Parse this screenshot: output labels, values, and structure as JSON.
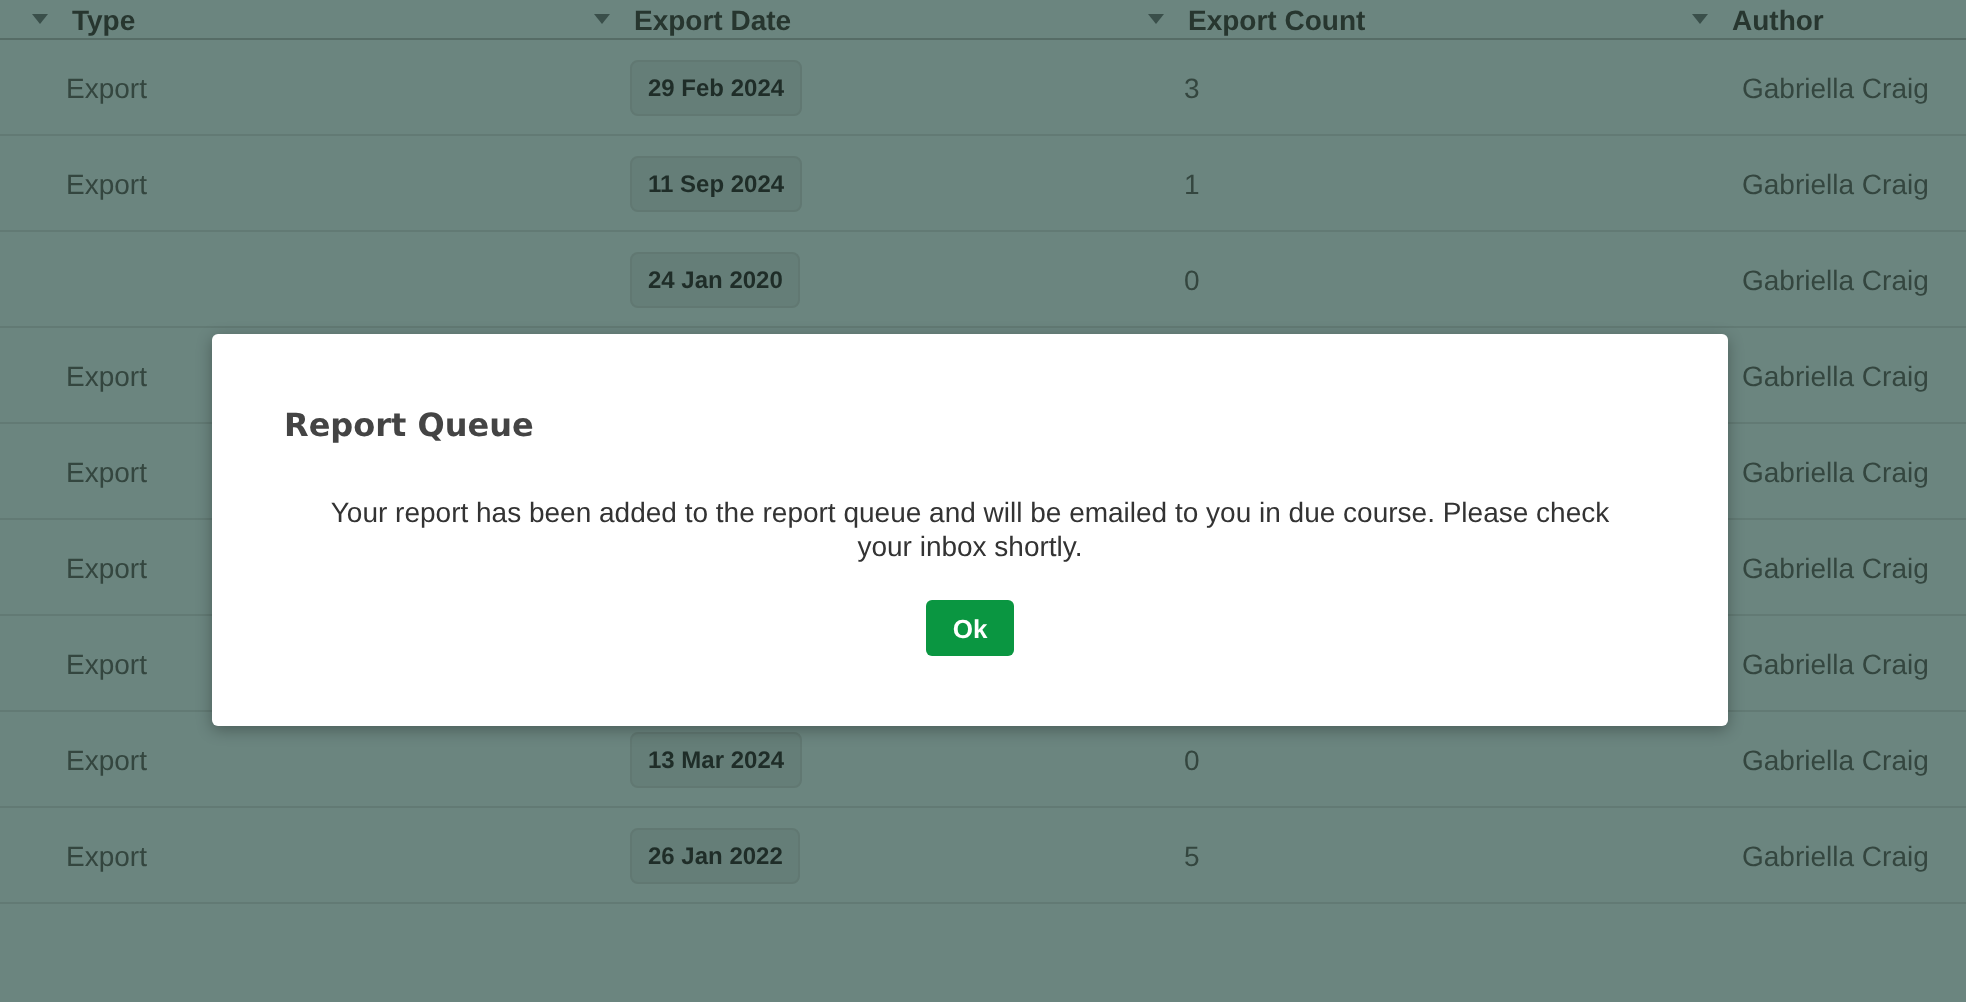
{
  "table": {
    "columns": [
      "Type",
      "Export Date",
      "Export Count",
      "Author"
    ],
    "rows": [
      {
        "type": "Export",
        "export_date": "29 Feb 2024",
        "export_count": "3",
        "author": "Gabriella Craig"
      },
      {
        "type": "Export",
        "export_date": "11 Sep 2024",
        "export_count": "1",
        "author": "Gabriella Craig"
      },
      {
        "export_date": "24 Jan 2020",
        "export_count": "0",
        "author": "Gabriella Craig"
      },
      {
        "type": "Export",
        "author": "Gabriella Craig"
      },
      {
        "type": "Export",
        "author": "Gabriella Craig"
      },
      {
        "type": "Export",
        "author": "Gabriella Craig"
      },
      {
        "type": "Export",
        "author": "Gabriella Craig"
      },
      {
        "type": "Export",
        "export_date": "13 Mar 2024",
        "export_count": "0",
        "author": "Gabriella Craig"
      },
      {
        "type": "Export",
        "export_date": "26 Jan 2022",
        "export_count": "5",
        "author": "Gabriella Craig"
      }
    ]
  },
  "dialog": {
    "title": "Report Queue",
    "message": "Your report has been added to the report queue and will be emailed to you in due course. Please check your inbox shortly.",
    "button": "Ok"
  }
}
